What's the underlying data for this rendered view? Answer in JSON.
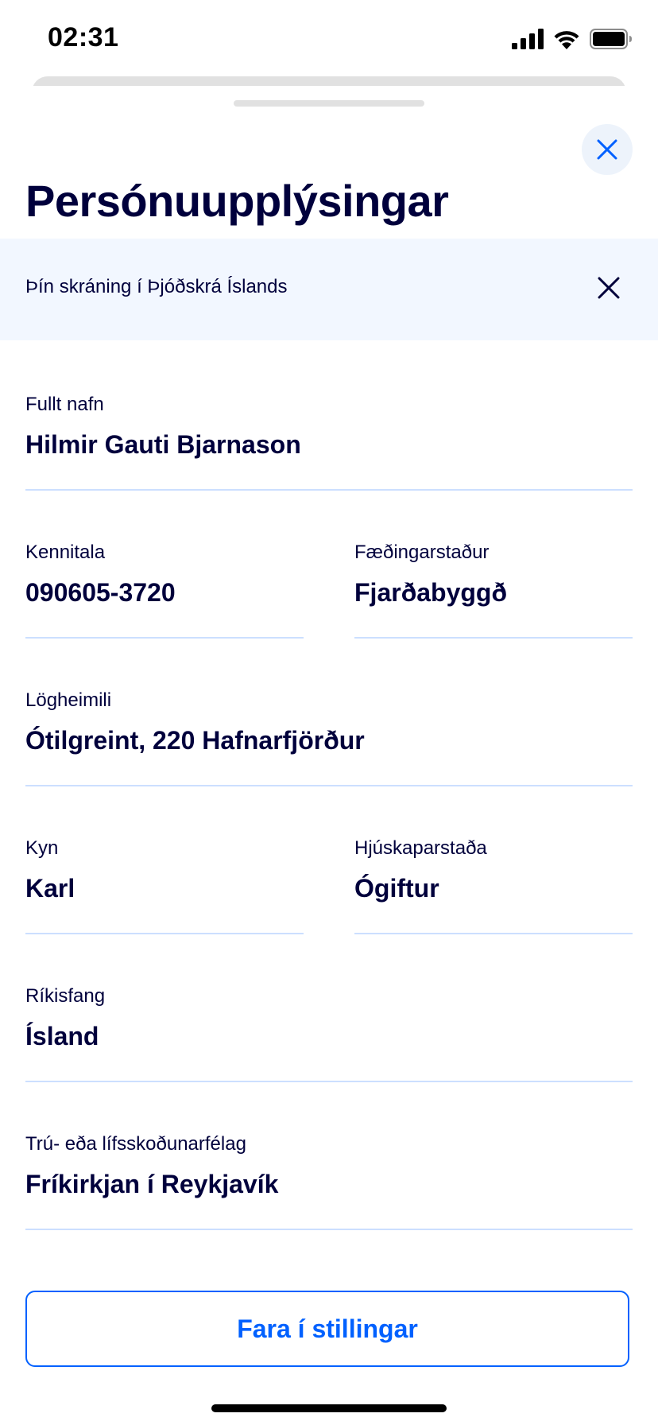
{
  "status_bar": {
    "time": "02:31",
    "icons": [
      "cellular-signal-icon",
      "wifi-icon",
      "battery-icon"
    ]
  },
  "header": {
    "title": "Persónuupplýsingar",
    "close_icon": "close-icon"
  },
  "banner": {
    "text": "Þín skráning í Þjóðskrá Íslands",
    "dismiss_icon": "close-icon"
  },
  "fields": {
    "full_name": {
      "label": "Fullt nafn",
      "value": "Hilmir Gauti Bjarnason"
    },
    "kennitala": {
      "label": "Kennitala",
      "value": "090605-3720"
    },
    "birthplace": {
      "label": "Fæðingarstaður",
      "value": "Fjarðabyggð"
    },
    "domicile": {
      "label": "Lögheimili",
      "value": "Ótilgreint, 220 Hafnarfjörður"
    },
    "gender": {
      "label": "Kyn",
      "value": "Karl"
    },
    "marital_status": {
      "label": "Hjúskaparstaða",
      "value": "Ógiftur"
    },
    "citizenship": {
      "label": "Ríkisfang",
      "value": "Ísland"
    },
    "religion": {
      "label": "Trú- eða lífsskoðunarfélag",
      "value": "Fríkirkjan í Reykjavík"
    }
  },
  "actions": {
    "settings_label": "Fara í stillingar"
  },
  "colors": {
    "text": "#00003C",
    "accent": "#0061FF",
    "banner_bg": "#F2F7FF",
    "divider": "#CCDFFF",
    "close_btn_bg": "#EDF3FB"
  }
}
